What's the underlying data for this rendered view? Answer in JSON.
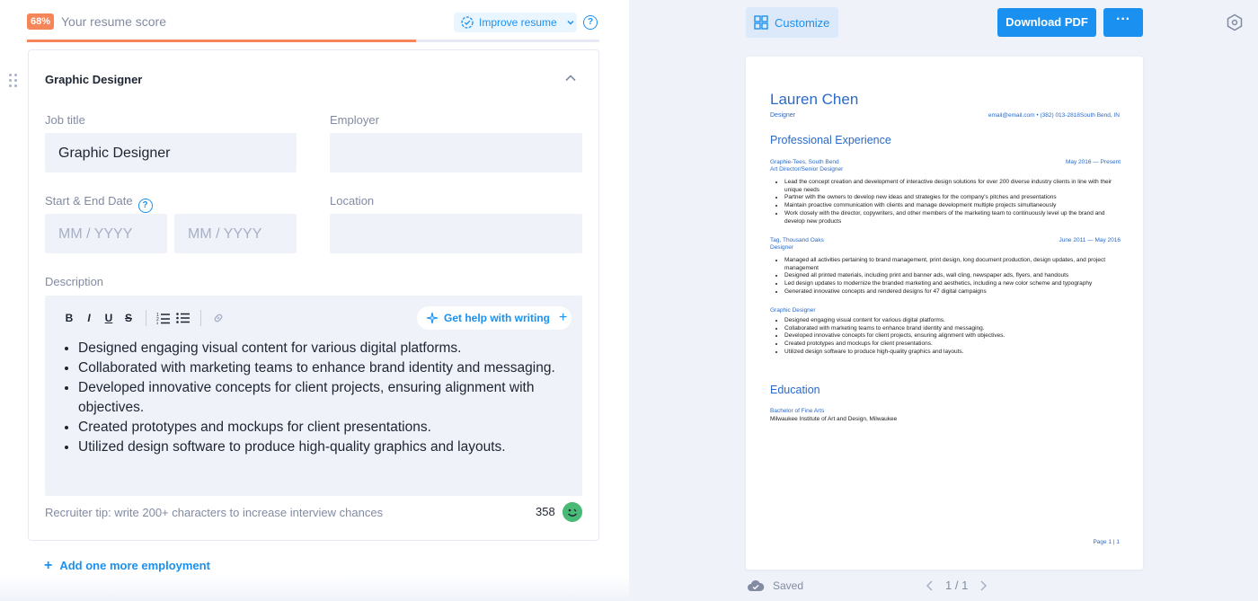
{
  "score": {
    "badge": "68%",
    "label": "Your resume score",
    "value_percent": 68
  },
  "improve": {
    "label": "Improve resume"
  },
  "help_icon": "?",
  "card": {
    "title": "Graphic Designer",
    "job_title": {
      "label": "Job title",
      "value": "Graphic Designer"
    },
    "employer": {
      "label": "Employer",
      "value": ""
    },
    "dates": {
      "label": "Start & End Date",
      "start_placeholder": "MM / YYYY",
      "end_placeholder": "MM / YYYY"
    },
    "location": {
      "label": "Location",
      "value": ""
    },
    "description": {
      "label": "Description",
      "toolbar": {
        "bold": "B",
        "italic": "I",
        "underline": "U",
        "strike": "S"
      },
      "ai_button": "Get help with writing",
      "bullets": [
        "Designed engaging visual content for various digital platforms.",
        "Collaborated with marketing teams to enhance brand identity and messaging.",
        "Developed innovative concepts for client projects, ensuring alignment with objectives.",
        "Created prototypes and mockups for client presentations.",
        "Utilized design software to produce high-quality graphics and layouts."
      ]
    },
    "tip": "Recruiter tip: write 200+ characters to increase interview chances",
    "char_count": "358"
  },
  "add_more": "Add one more employment",
  "right": {
    "customize": "Customize",
    "download": "Download PDF",
    "more": "···",
    "saved": "Saved",
    "pager": "1 / 1"
  },
  "resume": {
    "name": "Lauren Chen",
    "role": "Designer",
    "contact": "email@email.com • (382) 013-2818South Bend, IN",
    "experience_title": "Professional Experience",
    "entries": [
      {
        "head1": "Graphie-Tees, South Bend",
        "head2": "Art Director/Senior Designer",
        "date": "May 2016 — Present",
        "bullets": [
          "Lead the concept creation and development of interactive design solutions for over 200 diverse industry clients in line with their unique needs",
          "Partner with the owners to develop new ideas and strategies for the company's pitches and presentations",
          "Maintain proactive communication with clients and manage development multiple projects simultaneously",
          "Work closely with the director, copywriters, and other members of the marketing team to continuously level up the brand and develop new products"
        ]
      },
      {
        "head1": "Tag, Thousand Oaks",
        "head2": "Designer",
        "date": "June 2011 — May 2016",
        "bullets": [
          "Managed all activities pertaining to brand management, print design, long document production, design updates, and project management",
          "Designed all printed materials, including print and banner ads, wall cling, newspaper ads, flyers, and handouts",
          "Led design updates to modernize the branded marketing and aesthetics, including a new color scheme and typography",
          "Generated innovative concepts and rendered designs for 47 digital campaigns"
        ]
      },
      {
        "head1": "Graphic Designer",
        "head2": "",
        "date": "",
        "bullets": [
          "Designed engaging visual content for various digital platforms.",
          "Collaborated with marketing teams to enhance brand identity and messaging.",
          "Developed innovative concepts for client projects, ensuring alignment with objectives.",
          "Created prototypes and mockups for client presentations.",
          "Utilized design software to produce high-quality graphics and layouts."
        ]
      }
    ],
    "education_title": "Education",
    "education": {
      "degree": "Bachelor of Fine Arts",
      "school": "Milwaukee Institute of Art and Design, Milwaukee"
    },
    "page": "Page 1 | 1"
  },
  "colors": {
    "accent": "#1a91f0",
    "score": "#f68559",
    "resume_blue": "#2a6ac8",
    "field_bg": "#eff2f9"
  }
}
